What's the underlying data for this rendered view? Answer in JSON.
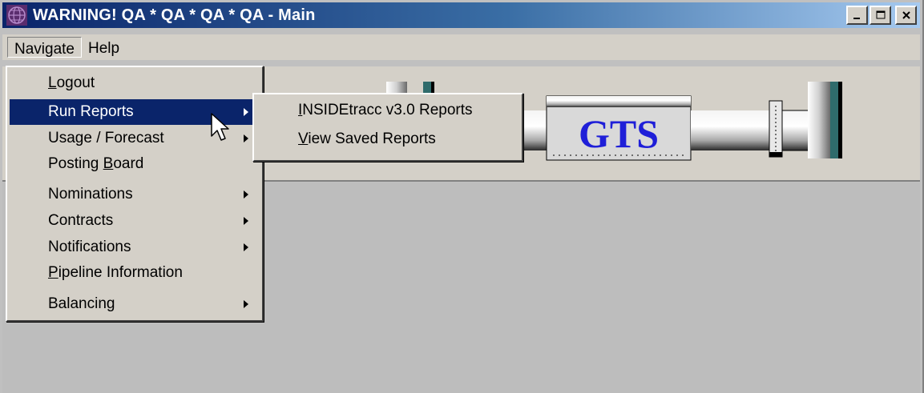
{
  "window": {
    "title": "WARNING!  QA * QA * QA * QA - Main"
  },
  "menubar": {
    "navigate": "Navigate",
    "help": "Help"
  },
  "navigate_menu": {
    "logout": {
      "first": "L",
      "rest": "ogout"
    },
    "run_reports": "Run Reports",
    "usage_forecast": "Usage / Forecast",
    "posting_board": {
      "pre": "Posting ",
      "ul": "B",
      "post": "oard"
    },
    "nominations": "Nominations",
    "contracts": "Contracts",
    "notifications": "Notifications",
    "pipeline_information": {
      "first": "P",
      "rest": "ipeline Information"
    },
    "balancing": "Balancing"
  },
  "reports_submenu": {
    "insidetracc": {
      "first": "I",
      "rest": "NSIDEtracc v3.0 Reports"
    },
    "view_saved": {
      "first": "V",
      "rest": "iew Saved Reports"
    }
  },
  "logo": {
    "text": "GTS"
  },
  "colors": {
    "selection": "#0a246a",
    "logo_text": "#1f1fd8",
    "titlebar_start": "#0a246a",
    "titlebar_end": "#a6caf0"
  }
}
